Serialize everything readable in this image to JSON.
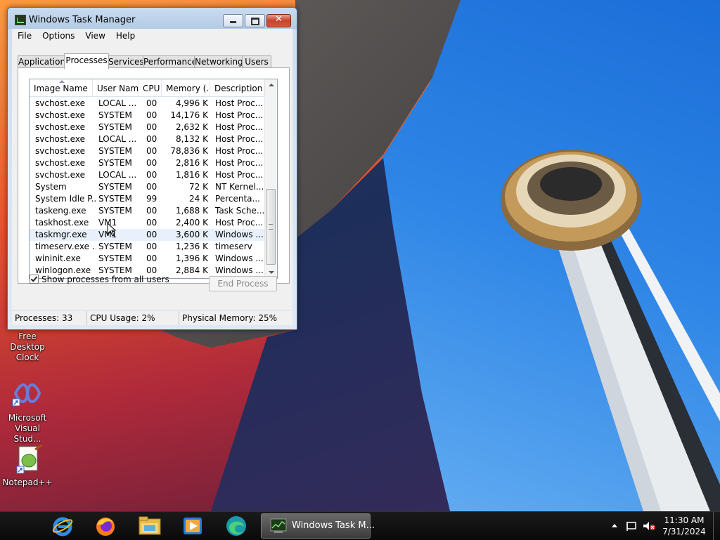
{
  "window": {
    "title": "Windows Task Manager",
    "menu": [
      "File",
      "Options",
      "View",
      "Help"
    ],
    "tabs": [
      "Applications",
      "Processes",
      "Services",
      "Performance",
      "Networking",
      "Users"
    ],
    "active_tab": "Processes",
    "columns": [
      "Image Name",
      "User Name",
      "CPU",
      "Memory (...",
      "Description"
    ],
    "rows": [
      {
        "name": "svchost.exe",
        "user": "LOCAL ...",
        "cpu": "00",
        "mem": "4,996 K",
        "desc": "Host Proc..."
      },
      {
        "name": "svchost.exe",
        "user": "SYSTEM",
        "cpu": "00",
        "mem": "14,176 K",
        "desc": "Host Proc..."
      },
      {
        "name": "svchost.exe",
        "user": "SYSTEM",
        "cpu": "00",
        "mem": "2,632 K",
        "desc": "Host Proc..."
      },
      {
        "name": "svchost.exe",
        "user": "LOCAL ...",
        "cpu": "00",
        "mem": "8,132 K",
        "desc": "Host Proc..."
      },
      {
        "name": "svchost.exe",
        "user": "SYSTEM",
        "cpu": "00",
        "mem": "78,836 K",
        "desc": "Host Proc..."
      },
      {
        "name": "svchost.exe",
        "user": "SYSTEM",
        "cpu": "00",
        "mem": "2,816 K",
        "desc": "Host Proc..."
      },
      {
        "name": "svchost.exe",
        "user": "LOCAL ...",
        "cpu": "00",
        "mem": "1,816 K",
        "desc": "Host Proc..."
      },
      {
        "name": "System",
        "user": "SYSTEM",
        "cpu": "00",
        "mem": "72 K",
        "desc": "NT Kernel..."
      },
      {
        "name": "System Idle P...",
        "user": "SYSTEM",
        "cpu": "99",
        "mem": "24 K",
        "desc": "Percenta..."
      },
      {
        "name": "taskeng.exe",
        "user": "SYSTEM",
        "cpu": "00",
        "mem": "1,688 K",
        "desc": "Task Sche..."
      },
      {
        "name": "taskhost.exe",
        "user": "VM1",
        "cpu": "00",
        "mem": "2,400 K",
        "desc": "Host Proc..."
      },
      {
        "name": "taskmgr.exe",
        "user": "VM1",
        "cpu": "00",
        "mem": "3,600 K",
        "desc": "Windows ..."
      },
      {
        "name": "timeserv.exe ...",
        "user": "SYSTEM",
        "cpu": "00",
        "mem": "1,236 K",
        "desc": "timeserv"
      },
      {
        "name": "wininit.exe",
        "user": "SYSTEM",
        "cpu": "00",
        "mem": "1,396 K",
        "desc": "Windows ..."
      },
      {
        "name": "winlogon.exe",
        "user": "SYSTEM",
        "cpu": "00",
        "mem": "2,884 K",
        "desc": "Windows ..."
      }
    ],
    "selected_row": 11,
    "show_all_label": "Show processes from all users",
    "show_all_checked": true,
    "end_process_label": "End Process",
    "status": {
      "processes": "Processes: 33",
      "cpu": "CPU Usage: 2%",
      "memory": "Physical Memory: 25%"
    }
  },
  "desktop_icons": [
    {
      "label": "Free Desktop Clock",
      "icon": "clock-icon"
    },
    {
      "label": "Microsoft Visual Stud...",
      "icon": "visual-studio-icon"
    },
    {
      "label": "Notepad++",
      "icon": "notepadpp-icon"
    }
  ],
  "taskbar": {
    "pinned": [
      "internet-explorer-icon",
      "firefox-icon",
      "file-explorer-icon",
      "media-player-icon",
      "edge-icon"
    ],
    "active_task_label": "Windows Task M...",
    "clock_time": "11:30 AM",
    "clock_date": "7/31/2024"
  }
}
